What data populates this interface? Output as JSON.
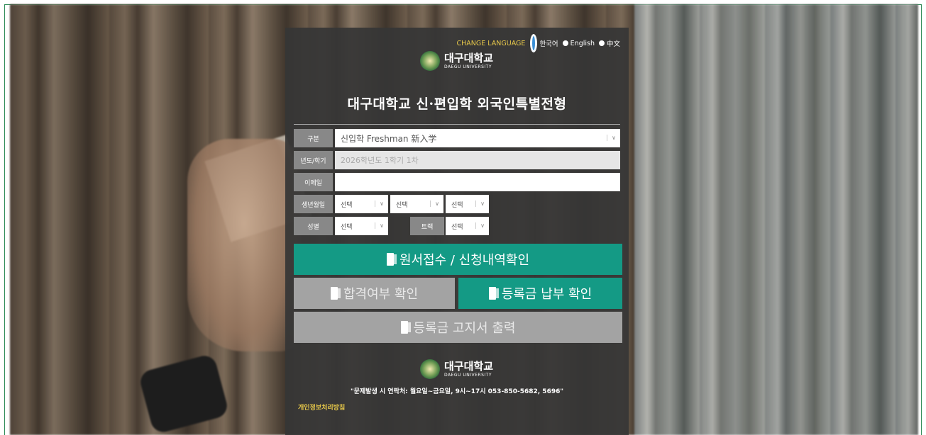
{
  "header": {
    "change_language": "CHANGE LANGUAGE",
    "languages": [
      {
        "label": "한국어",
        "selected": true
      },
      {
        "label": "English",
        "selected": false
      },
      {
        "label": "中文",
        "selected": false
      }
    ]
  },
  "logo": {
    "korean": "대구대학교",
    "english": "DAEGU UNIVERSITY"
  },
  "title": "대구대학교 신·편입학 외국인특별전형",
  "form": {
    "category_label": "구분",
    "category_value": "신입학  Freshman  新入学",
    "term_label": "년도/학기",
    "term_value": "2026학년도 1학기 1차",
    "email_label": "이메일",
    "email_value": "",
    "birth_label": "생년월일",
    "birth_year": "선택",
    "birth_month": "선택",
    "birth_day": "선택",
    "gender_label": "성별",
    "gender_value": "선택",
    "track_label": "트랙",
    "track_value": "선택"
  },
  "buttons": {
    "apply": "원서접수 / 신청내역확인",
    "result": "합격여부 확인",
    "tuition_paid": "등록금 납부 확인",
    "tuition_bill": "등록금 고지서 출력"
  },
  "footer": {
    "contact": "\"문제발생 시 연락처: 월요일~금요일, 9시~17시 053-850-5682, 5696\"",
    "privacy": "개인정보처리방침"
  },
  "colors": {
    "teal": "#149a85",
    "gray": "#a3a3a3",
    "panel": "#363636",
    "accent_yellow": "#e8c94a"
  }
}
